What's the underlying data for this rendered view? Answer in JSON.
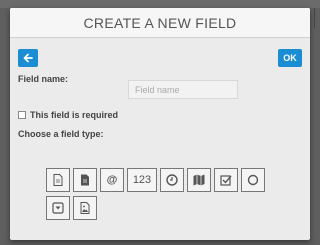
{
  "modal": {
    "title": "CREATE A NEW FIELD",
    "back_icon": "arrow-left-icon",
    "ok_label": "OK"
  },
  "form": {
    "name_label": "Field name:",
    "name_placeholder": "Field name",
    "name_value": "",
    "required_label": "This field is required",
    "required_checked": false,
    "choose_label": "Choose a field type:"
  },
  "field_types": [
    {
      "icon": "document-outline-icon"
    },
    {
      "icon": "document-filled-icon"
    },
    {
      "icon": "at-sign-icon",
      "label": "@"
    },
    {
      "icon": "number-icon",
      "label": "123"
    },
    {
      "icon": "clock-icon"
    },
    {
      "icon": "map-icon"
    },
    {
      "icon": "checkbox-icon"
    },
    {
      "icon": "radio-circle-icon"
    },
    {
      "icon": "dropdown-select-icon"
    },
    {
      "icon": "image-file-icon"
    }
  ],
  "colors": {
    "accent": "#1a8dd3",
    "modal_bg": "#ebebeb",
    "overlay": "#5f5f5f"
  }
}
